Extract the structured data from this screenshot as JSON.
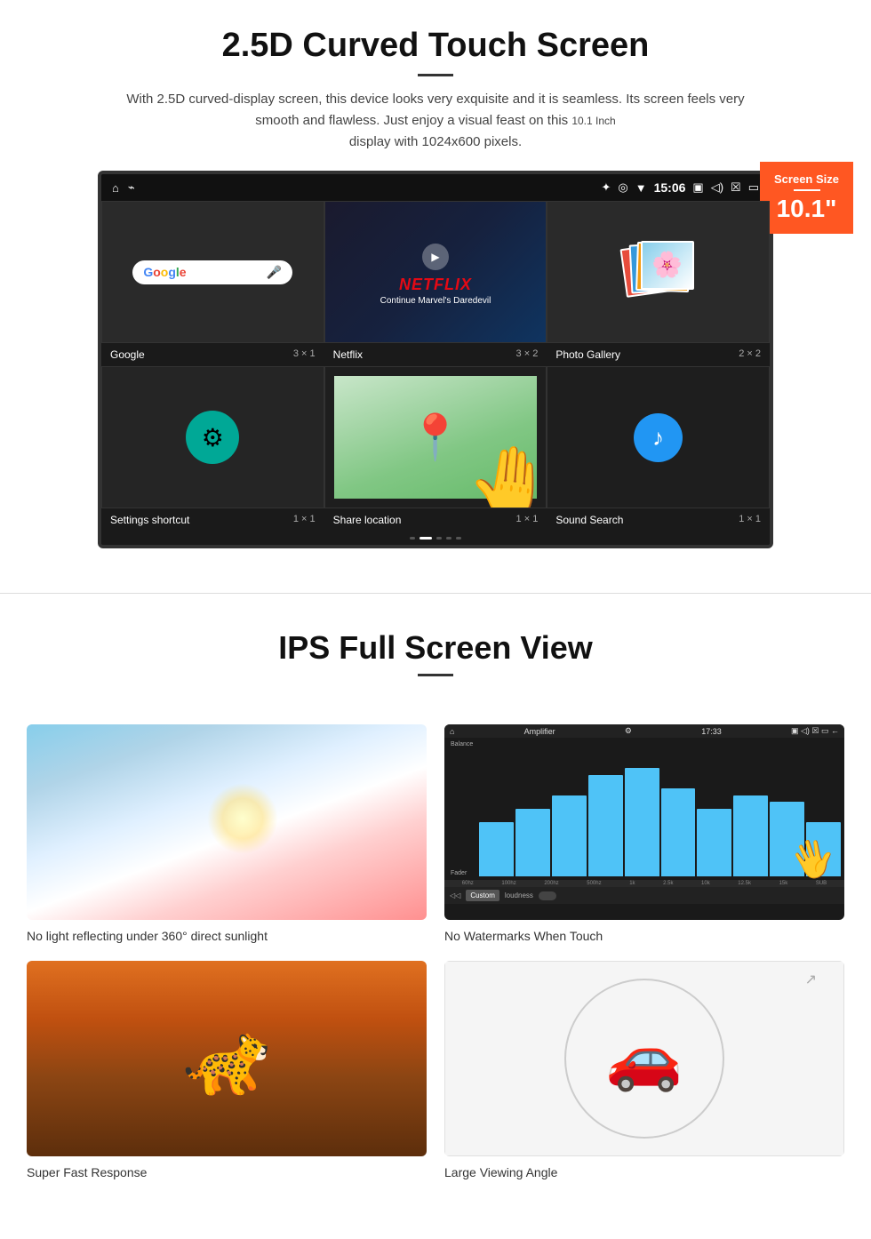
{
  "section1": {
    "title": "2.5D Curved Touch Screen",
    "description": "With 2.5D curved-display screen, this device looks very exquisite and it is seamless. Its screen feels very smooth and flawless. Just enjoy a visual feast on this",
    "screen_size_note": "10.1 Inch",
    "resolution_note": "display with 1024x600 pixels.",
    "badge": {
      "label": "Screen Size",
      "size": "10.1\""
    },
    "status_bar": {
      "time": "15:06"
    },
    "apps": [
      {
        "name": "Google",
        "grid": "3 × 1"
      },
      {
        "name": "Netflix",
        "grid": "3 × 2",
        "subtitle": "Continue Marvel's Daredevil"
      },
      {
        "name": "Photo Gallery",
        "grid": "2 × 2"
      },
      {
        "name": "Settings shortcut",
        "grid": "1 × 1"
      },
      {
        "name": "Share location",
        "grid": "1 × 1"
      },
      {
        "name": "Sound Search",
        "grid": "1 × 1"
      }
    ],
    "pagination_dots": 5
  },
  "section2": {
    "title": "IPS Full Screen View",
    "features": [
      {
        "id": "sunlight",
        "label": "No light reflecting under 360° direct sunlight"
      },
      {
        "id": "watermarks",
        "label": "No Watermarks When Touch"
      },
      {
        "id": "cheetah",
        "label": "Super Fast Response"
      },
      {
        "id": "car",
        "label": "Large Viewing Angle"
      }
    ],
    "eq": {
      "title": "Amplifier",
      "time": "17:33",
      "labels": [
        "60hz",
        "100hz",
        "200hz",
        "500hz",
        "1k",
        "2.5k",
        "10k",
        "12.5k",
        "15k",
        "SUB"
      ],
      "left_labels": [
        "Balance",
        "Fader"
      ],
      "heights": [
        40,
        50,
        55,
        65,
        70,
        60,
        45,
        55,
        50,
        35
      ],
      "custom_btn": "Custom",
      "loudness_label": "loudness"
    }
  }
}
